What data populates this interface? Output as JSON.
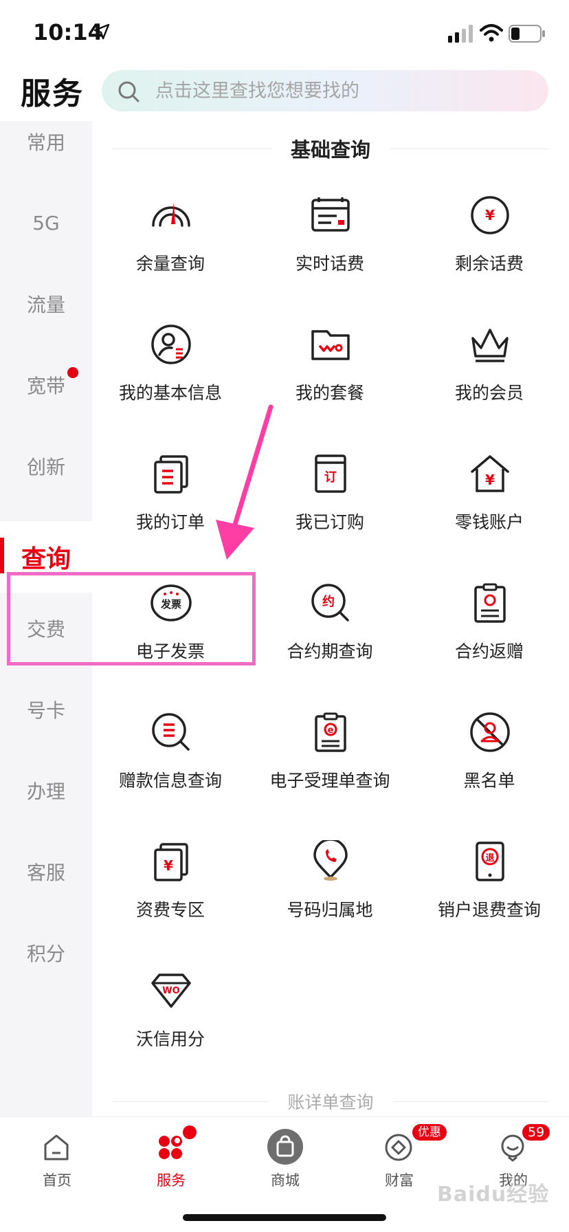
{
  "status_bar": {
    "time": "10:14"
  },
  "header": {
    "title": "服务",
    "search_placeholder": "点击这里查找您想要找的"
  },
  "sidebar": {
    "items": [
      "常用",
      "5G",
      "流量",
      "宽带",
      "创新",
      "查询",
      "交费",
      "号卡",
      "办理",
      "客服",
      "积分"
    ],
    "active": "查询"
  },
  "section": {
    "title": "基础查询",
    "next_title": "账详单查询"
  },
  "tiles": [
    "余量查询",
    "实时话费",
    "剩余话费",
    "我的基本信息",
    "我的套餐",
    "我的会员",
    "我的订单",
    "我已订购",
    "零钱账户",
    "电子发票",
    "合约期查询",
    "合约返赠",
    "赠款信息查询",
    "电子受理单查询",
    "黑名单",
    "资费专区",
    "号码归属地",
    "销户退费查询",
    "沃信用分"
  ],
  "icon_text": {
    "invoice": "发票",
    "contract": "约",
    "order": "订",
    "refund": "退",
    "wo": "WO",
    "yuan": "¥",
    "e": "e"
  },
  "bottom_nav": {
    "items": [
      "首页",
      "服务",
      "商城",
      "财富",
      "我的"
    ],
    "badge_wealth": "优惠",
    "badge_mine": "59"
  },
  "watermark": "Baidu经验",
  "colors": {
    "accent": "#e60012",
    "highlight": "#f06bc6",
    "arrow": "#ff3ea5"
  }
}
